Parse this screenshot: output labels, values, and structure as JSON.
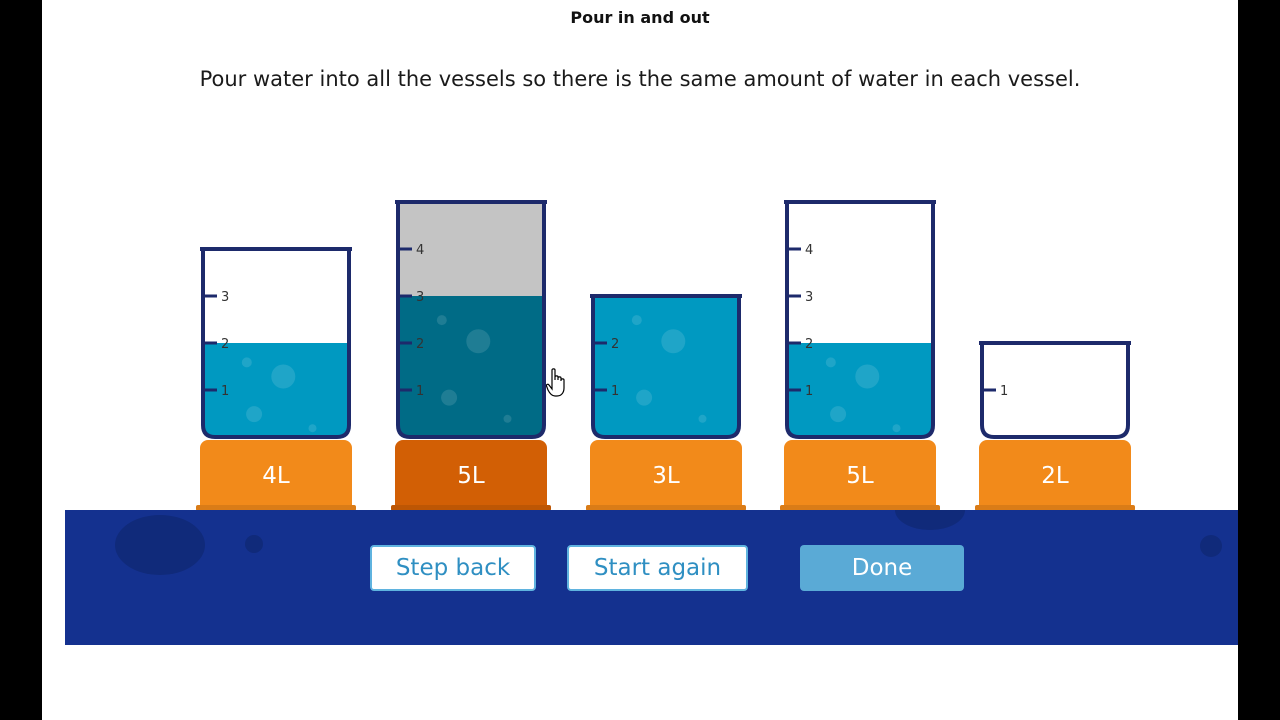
{
  "header": {
    "title": "Pour in and out",
    "instruction": "Pour water into all the vessels so there is the same amount of water in each vessel."
  },
  "vessels": [
    {
      "label": "4L",
      "capacity": 4,
      "water": 2,
      "selected": false,
      "tick_labels": [
        "1",
        "2",
        "3"
      ]
    },
    {
      "label": "5L",
      "capacity": 5,
      "water": 3,
      "selected": true,
      "tick_labels": [
        "1",
        "2",
        "3",
        "4"
      ]
    },
    {
      "label": "3L",
      "capacity": 3,
      "water": 3,
      "selected": false,
      "tick_labels": [
        "1",
        "2"
      ]
    },
    {
      "label": "5L",
      "capacity": 5,
      "water": 2,
      "selected": false,
      "tick_labels": [
        "1",
        "2",
        "3",
        "4"
      ]
    },
    {
      "label": "2L",
      "capacity": 2,
      "water": 0,
      "selected": false,
      "tick_labels": [
        "1"
      ]
    }
  ],
  "controls": {
    "step_back": "Step back",
    "start_again": "Start again",
    "done": "Done"
  },
  "colors": {
    "water": "#0099c1",
    "water_selected": "#006b86",
    "empty_selected": "#c4c4c4",
    "outline": "#1d2a6b",
    "base": "#f28a1a",
    "base_selected": "#d25f05",
    "bar": "#14318f"
  }
}
